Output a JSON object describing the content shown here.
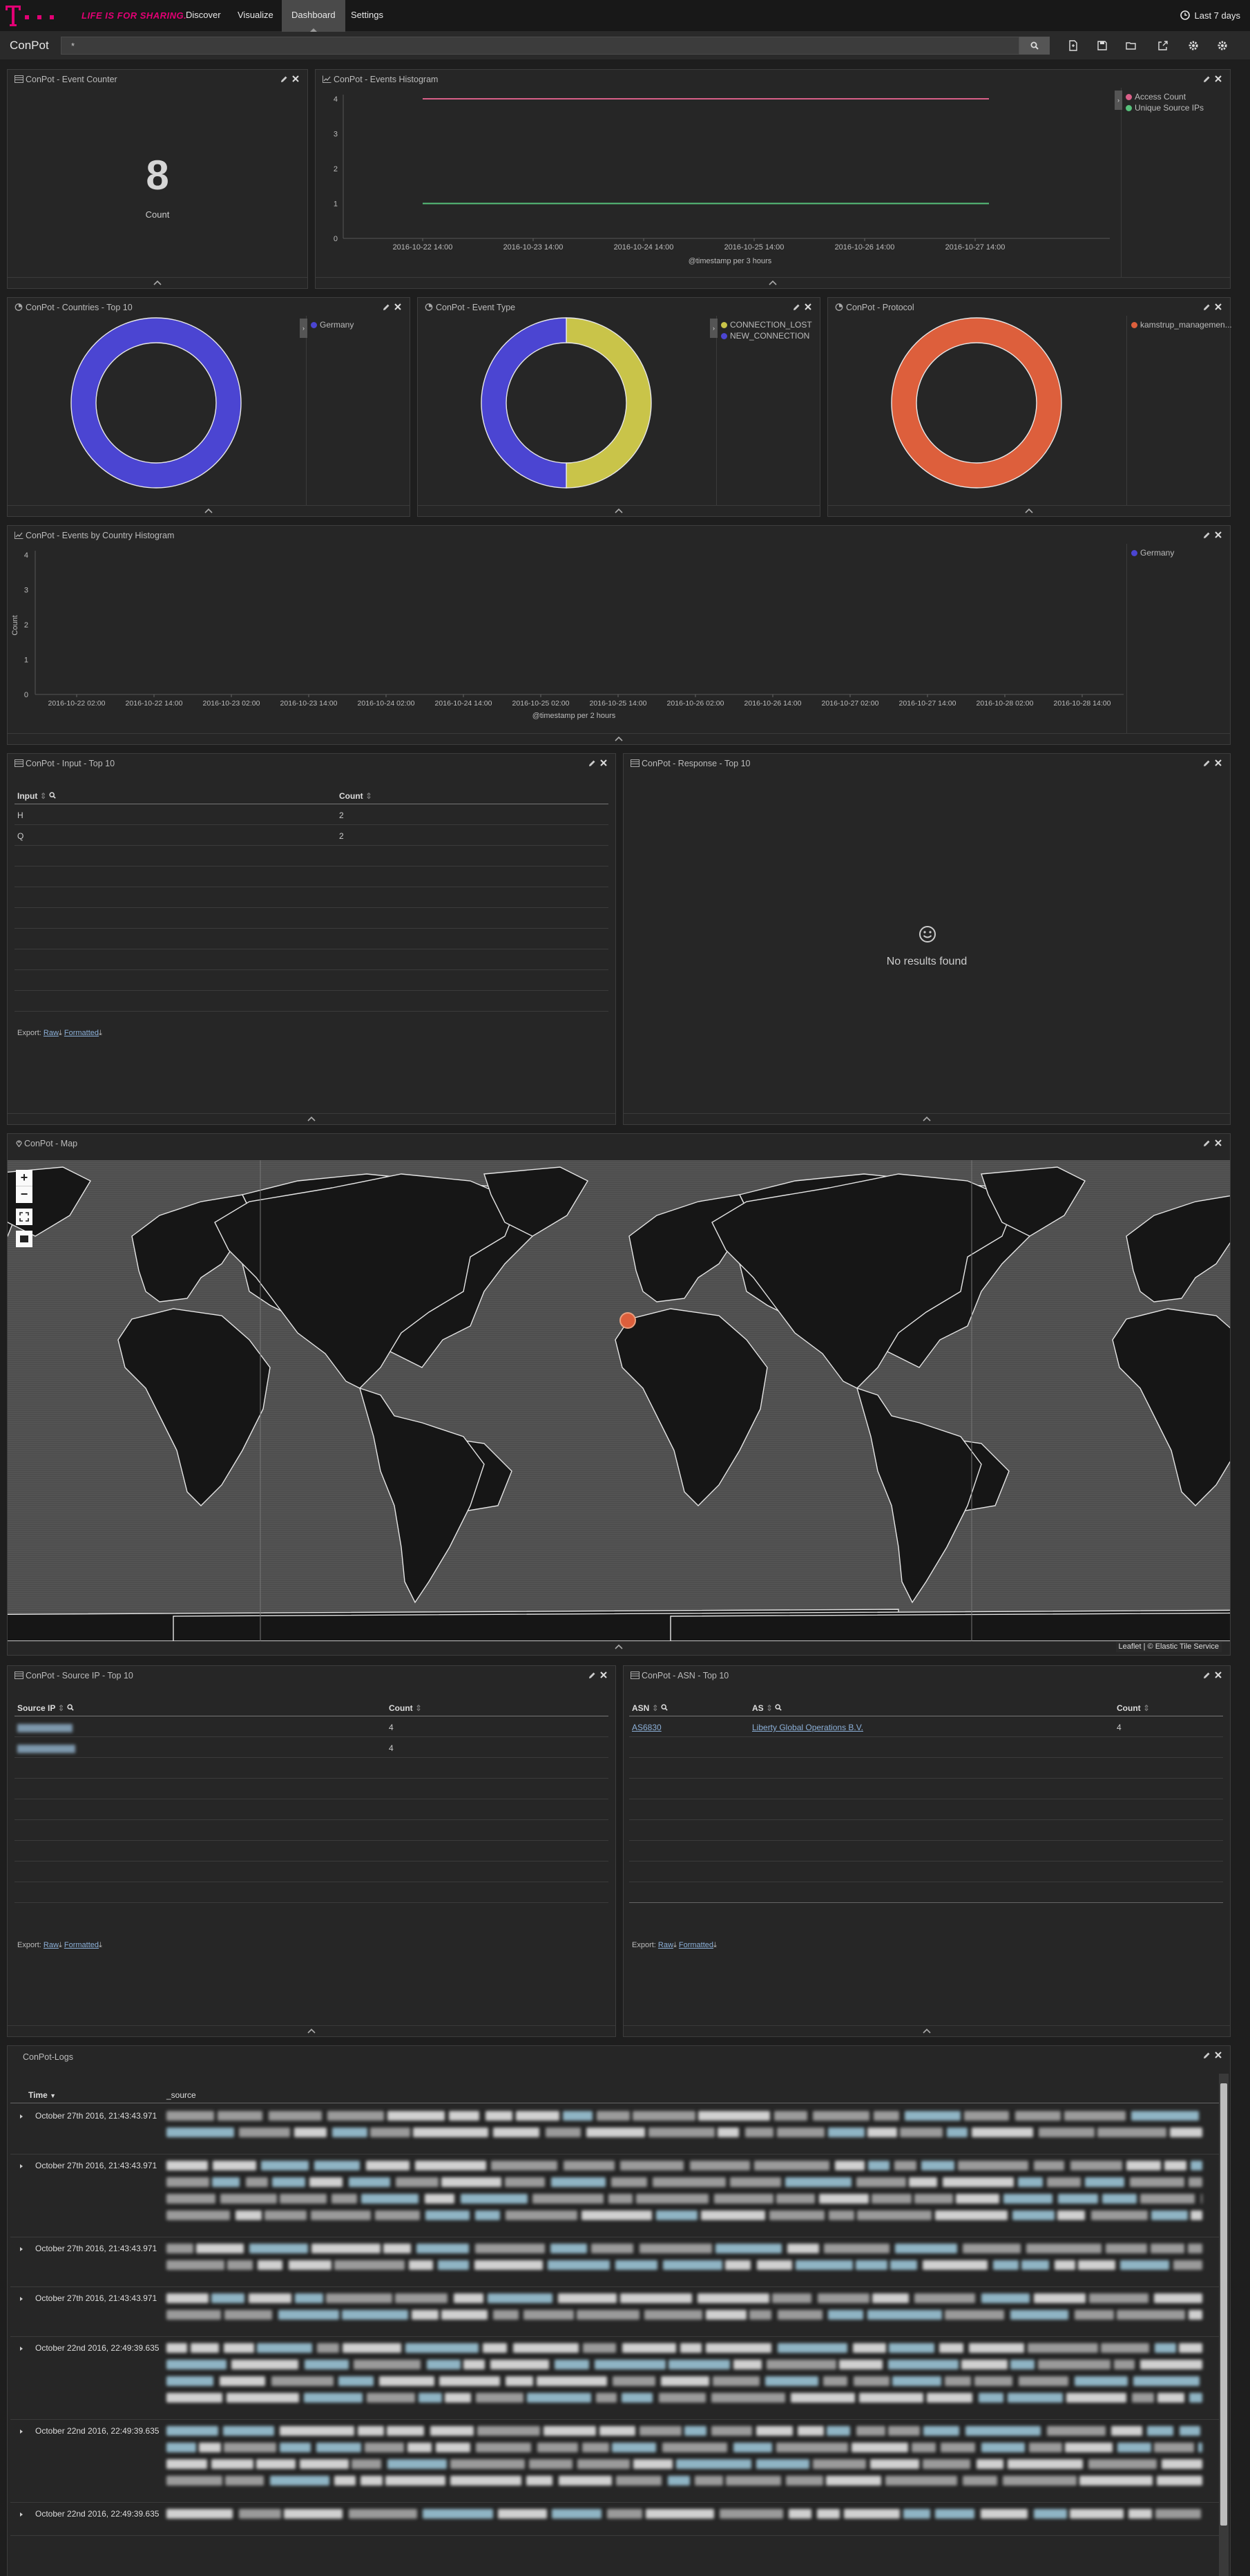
{
  "nav": {
    "slogan": "LIFE IS FOR SHARING.",
    "links": [
      "Discover",
      "Visualize",
      "Dashboard",
      "Settings"
    ],
    "time_range": "Last 7 days"
  },
  "dashboard": {
    "title": "ConPot"
  },
  "search": {
    "value": "*"
  },
  "panels": {
    "event_counter": {
      "title": "ConPot - Event Counter",
      "value": "8",
      "label": "Count"
    },
    "events_histogram": {
      "title": "ConPot - Events Histogram",
      "legend": [
        "Access Count",
        "Unique Source IPs"
      ],
      "xlabel": "@timestamp per 3 hours"
    },
    "countries": {
      "title": "ConPot - Countries - Top 10",
      "legend": [
        "Germany"
      ]
    },
    "event_type": {
      "title": "ConPot - Event Type",
      "legend": [
        "CONNECTION_LOST",
        "NEW_CONNECTION"
      ]
    },
    "protocol": {
      "title": "ConPot - Protocol",
      "legend": [
        "kamstrup_managemen..."
      ]
    },
    "country_histogram": {
      "title": "ConPot - Events by Country Histogram",
      "legend": [
        "Germany"
      ],
      "ylabel": "Count",
      "xlabel": "@timestamp per 2 hours"
    },
    "input": {
      "title": "ConPot - Input - Top 10",
      "headers": [
        "Input",
        "Count"
      ],
      "rows": [
        [
          "H",
          "2"
        ],
        [
          "Q",
          "2"
        ]
      ],
      "export": {
        "label": "Export:",
        "raw": "Raw",
        "formatted": "Formatted"
      }
    },
    "response": {
      "title": "ConPot - Response - Top 10",
      "empty": "No results found"
    },
    "map": {
      "title": "ConPot - Map",
      "attribution": "Leaflet | © Elastic Tile Service"
    },
    "source_ip": {
      "title": "ConPot - Source IP - Top 10",
      "headers": [
        "Source IP",
        "Count"
      ],
      "rows": [
        [
          "",
          "4"
        ],
        [
          "",
          "4"
        ]
      ],
      "export": {
        "label": "Export:",
        "raw": "Raw",
        "formatted": "Formatted"
      }
    },
    "asn": {
      "title": "ConPot - ASN - Top 10",
      "headers": [
        "ASN",
        "AS",
        "Count"
      ],
      "rows": [
        [
          "AS6830",
          "Liberty Global Operations B.V.",
          "4"
        ]
      ],
      "export": {
        "label": "Export:",
        "raw": "Raw",
        "formatted": "Formatted"
      }
    },
    "logs": {
      "title": "ConPot-Logs",
      "headers": [
        "Time",
        "_source"
      ],
      "rows": [
        "October 27th 2016, 21:43:43.971",
        "October 27th 2016, 21:43:43.971",
        "October 27th 2016, 21:43:43.971",
        "October 27th 2016, 21:43:43.971",
        "October 22nd 2016, 22:49:39.635",
        "October 22nd 2016, 22:49:39.635",
        "October 22nd 2016, 22:49:39.635"
      ]
    }
  },
  "chart_data": [
    {
      "type": "line",
      "title": "",
      "x": [
        "2016-10-22 14:00",
        "2016-10-27 17:00"
      ],
      "x_ticks": [
        "2016-10-22 14:00",
        "2016-10-23 14:00",
        "2016-10-24 14:00",
        "2016-10-25 14:00",
        "2016-10-26 14:00",
        "2016-10-27 14:00"
      ],
      "series": [
        {
          "name": "Access Count",
          "values": [
            4,
            4
          ]
        },
        {
          "name": "Unique Source IPs",
          "values": [
            1,
            1
          ]
        }
      ],
      "y_ticks": [
        0,
        1,
        2,
        3,
        4
      ],
      "ylim": [
        0,
        4
      ],
      "xlabel": "@timestamp per 3 hours",
      "legend": "right"
    },
    {
      "type": "pie",
      "title": "",
      "labels": [
        "Germany"
      ],
      "values": [
        8
      ],
      "legend": "right"
    },
    {
      "type": "pie",
      "title": "",
      "labels": [
        "CONNECTION_LOST",
        "NEW_CONNECTION"
      ],
      "values": [
        4,
        4
      ],
      "legend": "right"
    },
    {
      "type": "pie",
      "title": "",
      "labels": [
        "kamstrup_managemen..."
      ],
      "values": [
        8
      ],
      "legend": "right"
    },
    {
      "type": "bar",
      "title": "",
      "x_ticks": [
        "2016-10-22 02:00",
        "2016-10-22 14:00",
        "2016-10-23 02:00",
        "2016-10-23 14:00",
        "2016-10-24 02:00",
        "2016-10-24 14:00",
        "2016-10-25 02:00",
        "2016-10-25 14:00",
        "2016-10-26 02:00",
        "2016-10-26 14:00",
        "2016-10-27 02:00",
        "2016-10-27 14:00",
        "2016-10-28 02:00",
        "2016-10-28 14:00"
      ],
      "y_ticks": [
        0,
        1,
        2,
        3,
        4
      ],
      "ylim": [
        0,
        4
      ],
      "ylabel": "Count",
      "xlabel": "@timestamp per 2 hours",
      "series": [
        {
          "name": "Germany",
          "values": []
        }
      ],
      "legend": "right"
    }
  ],
  "colors": {
    "magenta": "#e20074",
    "pink_line": "#d95f88",
    "green_line": "#57c17b",
    "purple": "#4b45d2",
    "yellow": "#c9c449",
    "orange": "#dd5f3c"
  }
}
